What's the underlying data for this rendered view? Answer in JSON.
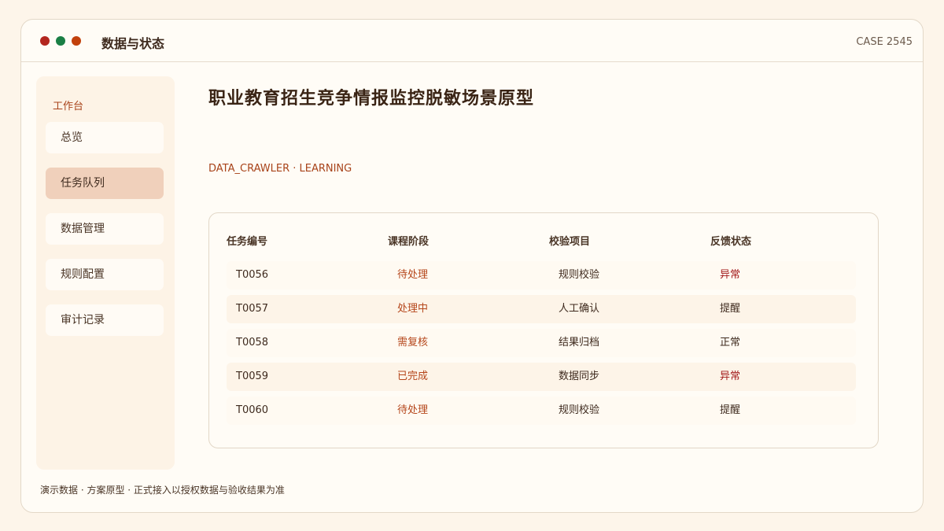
{
  "window": {
    "title": "数据与状态",
    "case_id": "CASE 2545"
  },
  "sidebar": {
    "heading": "工作台",
    "items": [
      {
        "label": "总览",
        "active": false
      },
      {
        "label": "任务队列",
        "active": true
      },
      {
        "label": "数据管理",
        "active": false
      },
      {
        "label": "规则配置",
        "active": false
      },
      {
        "label": "审计记录",
        "active": false
      }
    ]
  },
  "main": {
    "title": "职业教育招生竞争情报监控脱敏场景原型",
    "tag": "DATA_CRAWLER · LEARNING"
  },
  "table": {
    "headers": [
      "任务编号",
      "课程阶段",
      "校验项目",
      "反馈状态"
    ],
    "rows": [
      {
        "id": "T0056",
        "stage": "待处理",
        "check": "规则校验",
        "status": "异常"
      },
      {
        "id": "T0057",
        "stage": "处理中",
        "check": "人工确认",
        "status": "提醒"
      },
      {
        "id": "T0058",
        "stage": "需复核",
        "check": "结果归档",
        "status": "正常"
      },
      {
        "id": "T0059",
        "stage": "已完成",
        "check": "数据同步",
        "status": "异常"
      },
      {
        "id": "T0060",
        "stage": "待处理",
        "check": "规则校验",
        "status": "提醒"
      }
    ]
  },
  "footer": {
    "note": "演示数据 · 方案原型 · 正式接入以授权数据与验收结果为准"
  },
  "colors": {
    "accent": "#a8431a",
    "alert": "#a31b1b",
    "active_nav": "#f0d0bb",
    "traffic_red": "#b3261e",
    "traffic_green": "#1a7f45",
    "traffic_orange": "#c2410c"
  }
}
